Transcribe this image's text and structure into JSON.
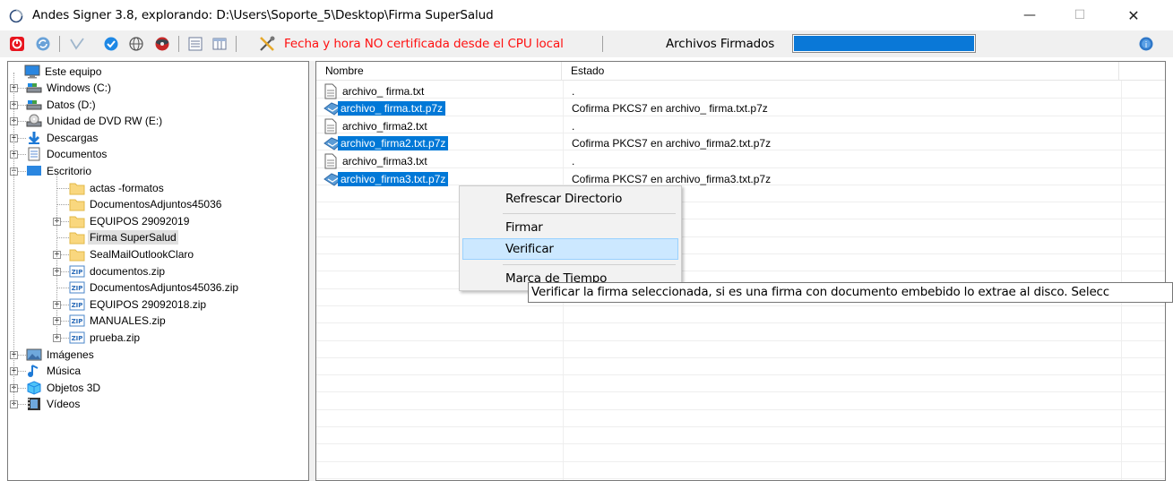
{
  "window": {
    "title": "Andes Signer 3.8, explorando: D:\\Users\\Soporte_5\\Desktop\\Firma SuperSalud",
    "minimize_glyph": "—",
    "maximize_glyph": "☐",
    "close_glyph": "✕"
  },
  "toolbar": {
    "cert_warning": "Fecha y hora NO certificada desde el CPU local",
    "signed_files_label": "Archivos Firmados",
    "signed_files_progress": 1.0,
    "icons": [
      "stop-icon",
      "refresh-icon",
      "sign-icon",
      "check-icon",
      "globe-icon",
      "disk-icon",
      "list-view-icon",
      "details-view-icon",
      "tools-icon",
      "help-icon"
    ],
    "colors": {
      "warning": "#ff1010",
      "progress": "#0a78d7"
    }
  },
  "tree": {
    "root": "Este equipo",
    "items": [
      {
        "label": "Windows (C:)",
        "icon": "drive-icon",
        "expandable": true
      },
      {
        "label": "Datos (D:)",
        "icon": "drive-icon",
        "expandable": true
      },
      {
        "label": "Unidad de DVD RW (E:)",
        "icon": "dvd-drive-icon",
        "expandable": true
      },
      {
        "label": "Descargas",
        "icon": "download-folder-icon",
        "expandable": true
      },
      {
        "label": "Documentos",
        "icon": "documents-folder-icon",
        "expandable": true
      },
      {
        "label": "Escritorio",
        "icon": "desktop-folder-icon",
        "expandable": true,
        "expanded": true
      },
      {
        "label": "actas -formatos",
        "icon": "folder-icon",
        "expandable": false
      },
      {
        "label": "DocumentosAdjuntos45036",
        "icon": "folder-icon",
        "expandable": false
      },
      {
        "label": "EQUIPOS 29092019",
        "icon": "folder-icon",
        "expandable": true
      },
      {
        "label": "Firma SuperSalud",
        "icon": "folder-icon",
        "expandable": false,
        "selected": true
      },
      {
        "label": "SealMailOutlookClaro",
        "icon": "folder-icon",
        "expandable": true
      },
      {
        "label": "documentos.zip",
        "icon": "zip-icon",
        "expandable": true
      },
      {
        "label": "DocumentosAdjuntos45036.zip",
        "icon": "zip-icon",
        "expandable": false
      },
      {
        "label": "EQUIPOS 29092018.zip",
        "icon": "zip-icon",
        "expandable": true
      },
      {
        "label": "MANUALES.zip",
        "icon": "zip-icon",
        "expandable": true
      },
      {
        "label": "prueba.zip",
        "icon": "zip-icon",
        "expandable": true
      },
      {
        "label": "Imágenes",
        "icon": "pictures-folder-icon",
        "expandable": true
      },
      {
        "label": "Música",
        "icon": "music-folder-icon",
        "expandable": true
      },
      {
        "label": "Objetos 3D",
        "icon": "3d-objects-folder-icon",
        "expandable": true
      },
      {
        "label": "Vídeos",
        "icon": "videos-folder-icon",
        "expandable": true
      }
    ]
  },
  "list": {
    "columns": [
      "Nombre",
      "Estado"
    ],
    "rows": [
      {
        "name": "archivo_ firma.txt",
        "state": ".",
        "icon": "text-file-icon",
        "selected": false
      },
      {
        "name": "archivo_ firma.txt.p7z",
        "state": "Cofirma PKCS7 en archivo_ firma.txt.p7z",
        "icon": "signed-file-icon",
        "selected": true
      },
      {
        "name": "archivo_firma2.txt",
        "state": ".",
        "icon": "text-file-icon",
        "selected": false
      },
      {
        "name": "archivo_firma2.txt.p7z",
        "state": "Cofirma PKCS7 en archivo_firma2.txt.p7z",
        "icon": "signed-file-icon",
        "selected": true
      },
      {
        "name": "archivo_firma3.txt",
        "state": ".",
        "icon": "text-file-icon",
        "selected": false
      },
      {
        "name": "archivo_firma3.txt.p7z",
        "state": "Cofirma PKCS7 en archivo_firma3.txt.p7z",
        "icon": "signed-file-icon",
        "selected": true
      }
    ]
  },
  "context_menu": {
    "items": [
      "Refrescar Directorio",
      "Firmar",
      "Verificar",
      "Marca de Tiempo"
    ],
    "highlighted": "Verificar"
  },
  "tooltip": {
    "text": "Verificar la firma seleccionada, si es una firma con documento embebido lo extrae al disco. Selecc"
  }
}
